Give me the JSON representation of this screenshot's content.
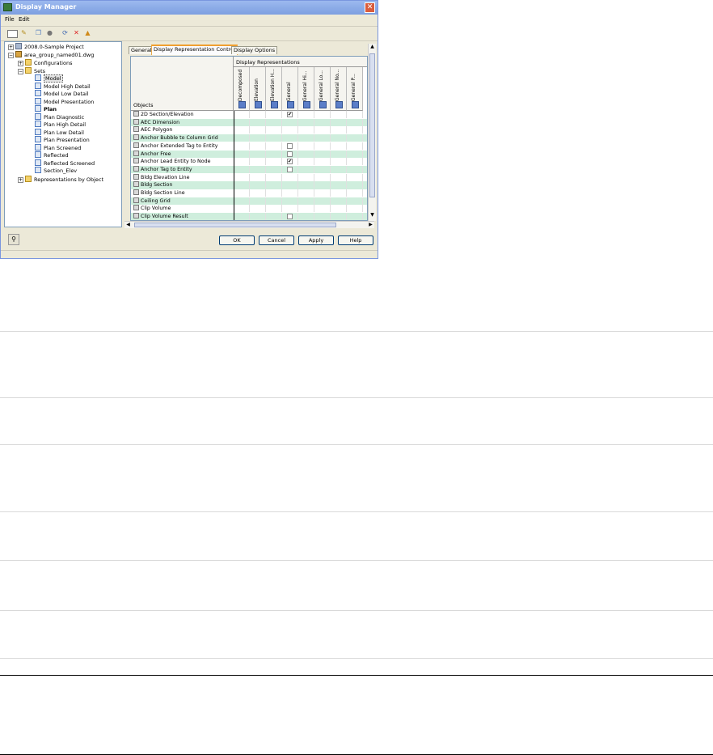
{
  "window": {
    "title": "Display Manager",
    "close_glyph": "✕",
    "menu": [
      "File",
      "Edit"
    ]
  },
  "toolbar": {
    "icons": [
      "new-icon",
      "open-icon",
      "copy-icon",
      "paste-icon",
      "refresh-icon",
      "delete-icon",
      "purge-icon"
    ]
  },
  "tree": {
    "nodes": [
      {
        "label": "2008.0-Sample Project",
        "icon": "project"
      },
      {
        "label": "area_group_named01.dwg",
        "icon": "drawing"
      },
      {
        "label": "Configurations",
        "icon": "folder"
      },
      {
        "label": "Sets",
        "icon": "folder"
      },
      {
        "label": "Model",
        "icon": "set"
      },
      {
        "label": "Model High Detail",
        "icon": "set"
      },
      {
        "label": "Model Low Detail",
        "icon": "set"
      },
      {
        "label": "Model Presentation",
        "icon": "set"
      },
      {
        "label": "Plan",
        "icon": "set"
      },
      {
        "label": "Plan Diagnostic",
        "icon": "set"
      },
      {
        "label": "Plan High Detail",
        "icon": "set"
      },
      {
        "label": "Plan Low Detail",
        "icon": "set"
      },
      {
        "label": "Plan Presentation",
        "icon": "set"
      },
      {
        "label": "Plan Screened",
        "icon": "set"
      },
      {
        "label": "Reflected",
        "icon": "set"
      },
      {
        "label": "Reflected Screened",
        "icon": "set"
      },
      {
        "label": "Section_Elev",
        "icon": "set"
      },
      {
        "label": "Representations by Object",
        "icon": "folder"
      }
    ]
  },
  "tabs": [
    "General",
    "Display Representation Control",
    "Display Options"
  ],
  "grid": {
    "objects_header": "Objects",
    "group_header": "Display Representations",
    "columns": [
      "Decomposed",
      "Elevation",
      "Elevation H...",
      "General",
      "General Hi...",
      "General Lo...",
      "General No...",
      "General P..."
    ],
    "rows": [
      {
        "label": "2D Section/Elevation",
        "checks": [
          null,
          null,
          null,
          true,
          null,
          null,
          null,
          null
        ]
      },
      {
        "label": "AEC Dimension",
        "checks": [
          null,
          null,
          null,
          null,
          null,
          null,
          null,
          null
        ]
      },
      {
        "label": "AEC Polygon",
        "checks": [
          null,
          null,
          null,
          null,
          null,
          null,
          null,
          null
        ]
      },
      {
        "label": "Anchor Bubble to Column Grid",
        "checks": [
          null,
          null,
          null,
          null,
          null,
          null,
          null,
          null
        ]
      },
      {
        "label": "Anchor Extended Tag to Entity",
        "checks": [
          null,
          null,
          null,
          false,
          null,
          null,
          null,
          null
        ]
      },
      {
        "label": "Anchor Free",
        "checks": [
          null,
          null,
          null,
          false,
          null,
          null,
          null,
          null
        ]
      },
      {
        "label": "Anchor Lead Entity to Node",
        "checks": [
          null,
          null,
          null,
          true,
          null,
          null,
          null,
          null
        ]
      },
      {
        "label": "Anchor Tag to Entity",
        "checks": [
          null,
          null,
          null,
          false,
          null,
          null,
          null,
          null
        ]
      },
      {
        "label": "Bldg Elevation Line",
        "checks": [
          null,
          null,
          null,
          null,
          null,
          null,
          null,
          null
        ]
      },
      {
        "label": "Bldg Section",
        "checks": [
          null,
          null,
          null,
          null,
          null,
          null,
          null,
          null
        ]
      },
      {
        "label": "Bldg Section Line",
        "checks": [
          null,
          null,
          null,
          null,
          null,
          null,
          null,
          null
        ]
      },
      {
        "label": "Ceiling Grid",
        "checks": [
          null,
          null,
          null,
          null,
          null,
          null,
          null,
          null
        ]
      },
      {
        "label": "Clip Volume",
        "checks": [
          null,
          null,
          null,
          null,
          null,
          null,
          null,
          null
        ]
      },
      {
        "label": "Clip Volume Result",
        "checks": [
          null,
          null,
          null,
          false,
          null,
          null,
          null,
          null
        ]
      }
    ]
  },
  "buttons": {
    "ok": "OK",
    "cancel": "Cancel",
    "apply": "Apply",
    "help": "Help"
  },
  "colors": {
    "titlebar": "#7d9fe0",
    "row_alt": "#cfeedd",
    "dialog_bg": "#ece9d8"
  }
}
